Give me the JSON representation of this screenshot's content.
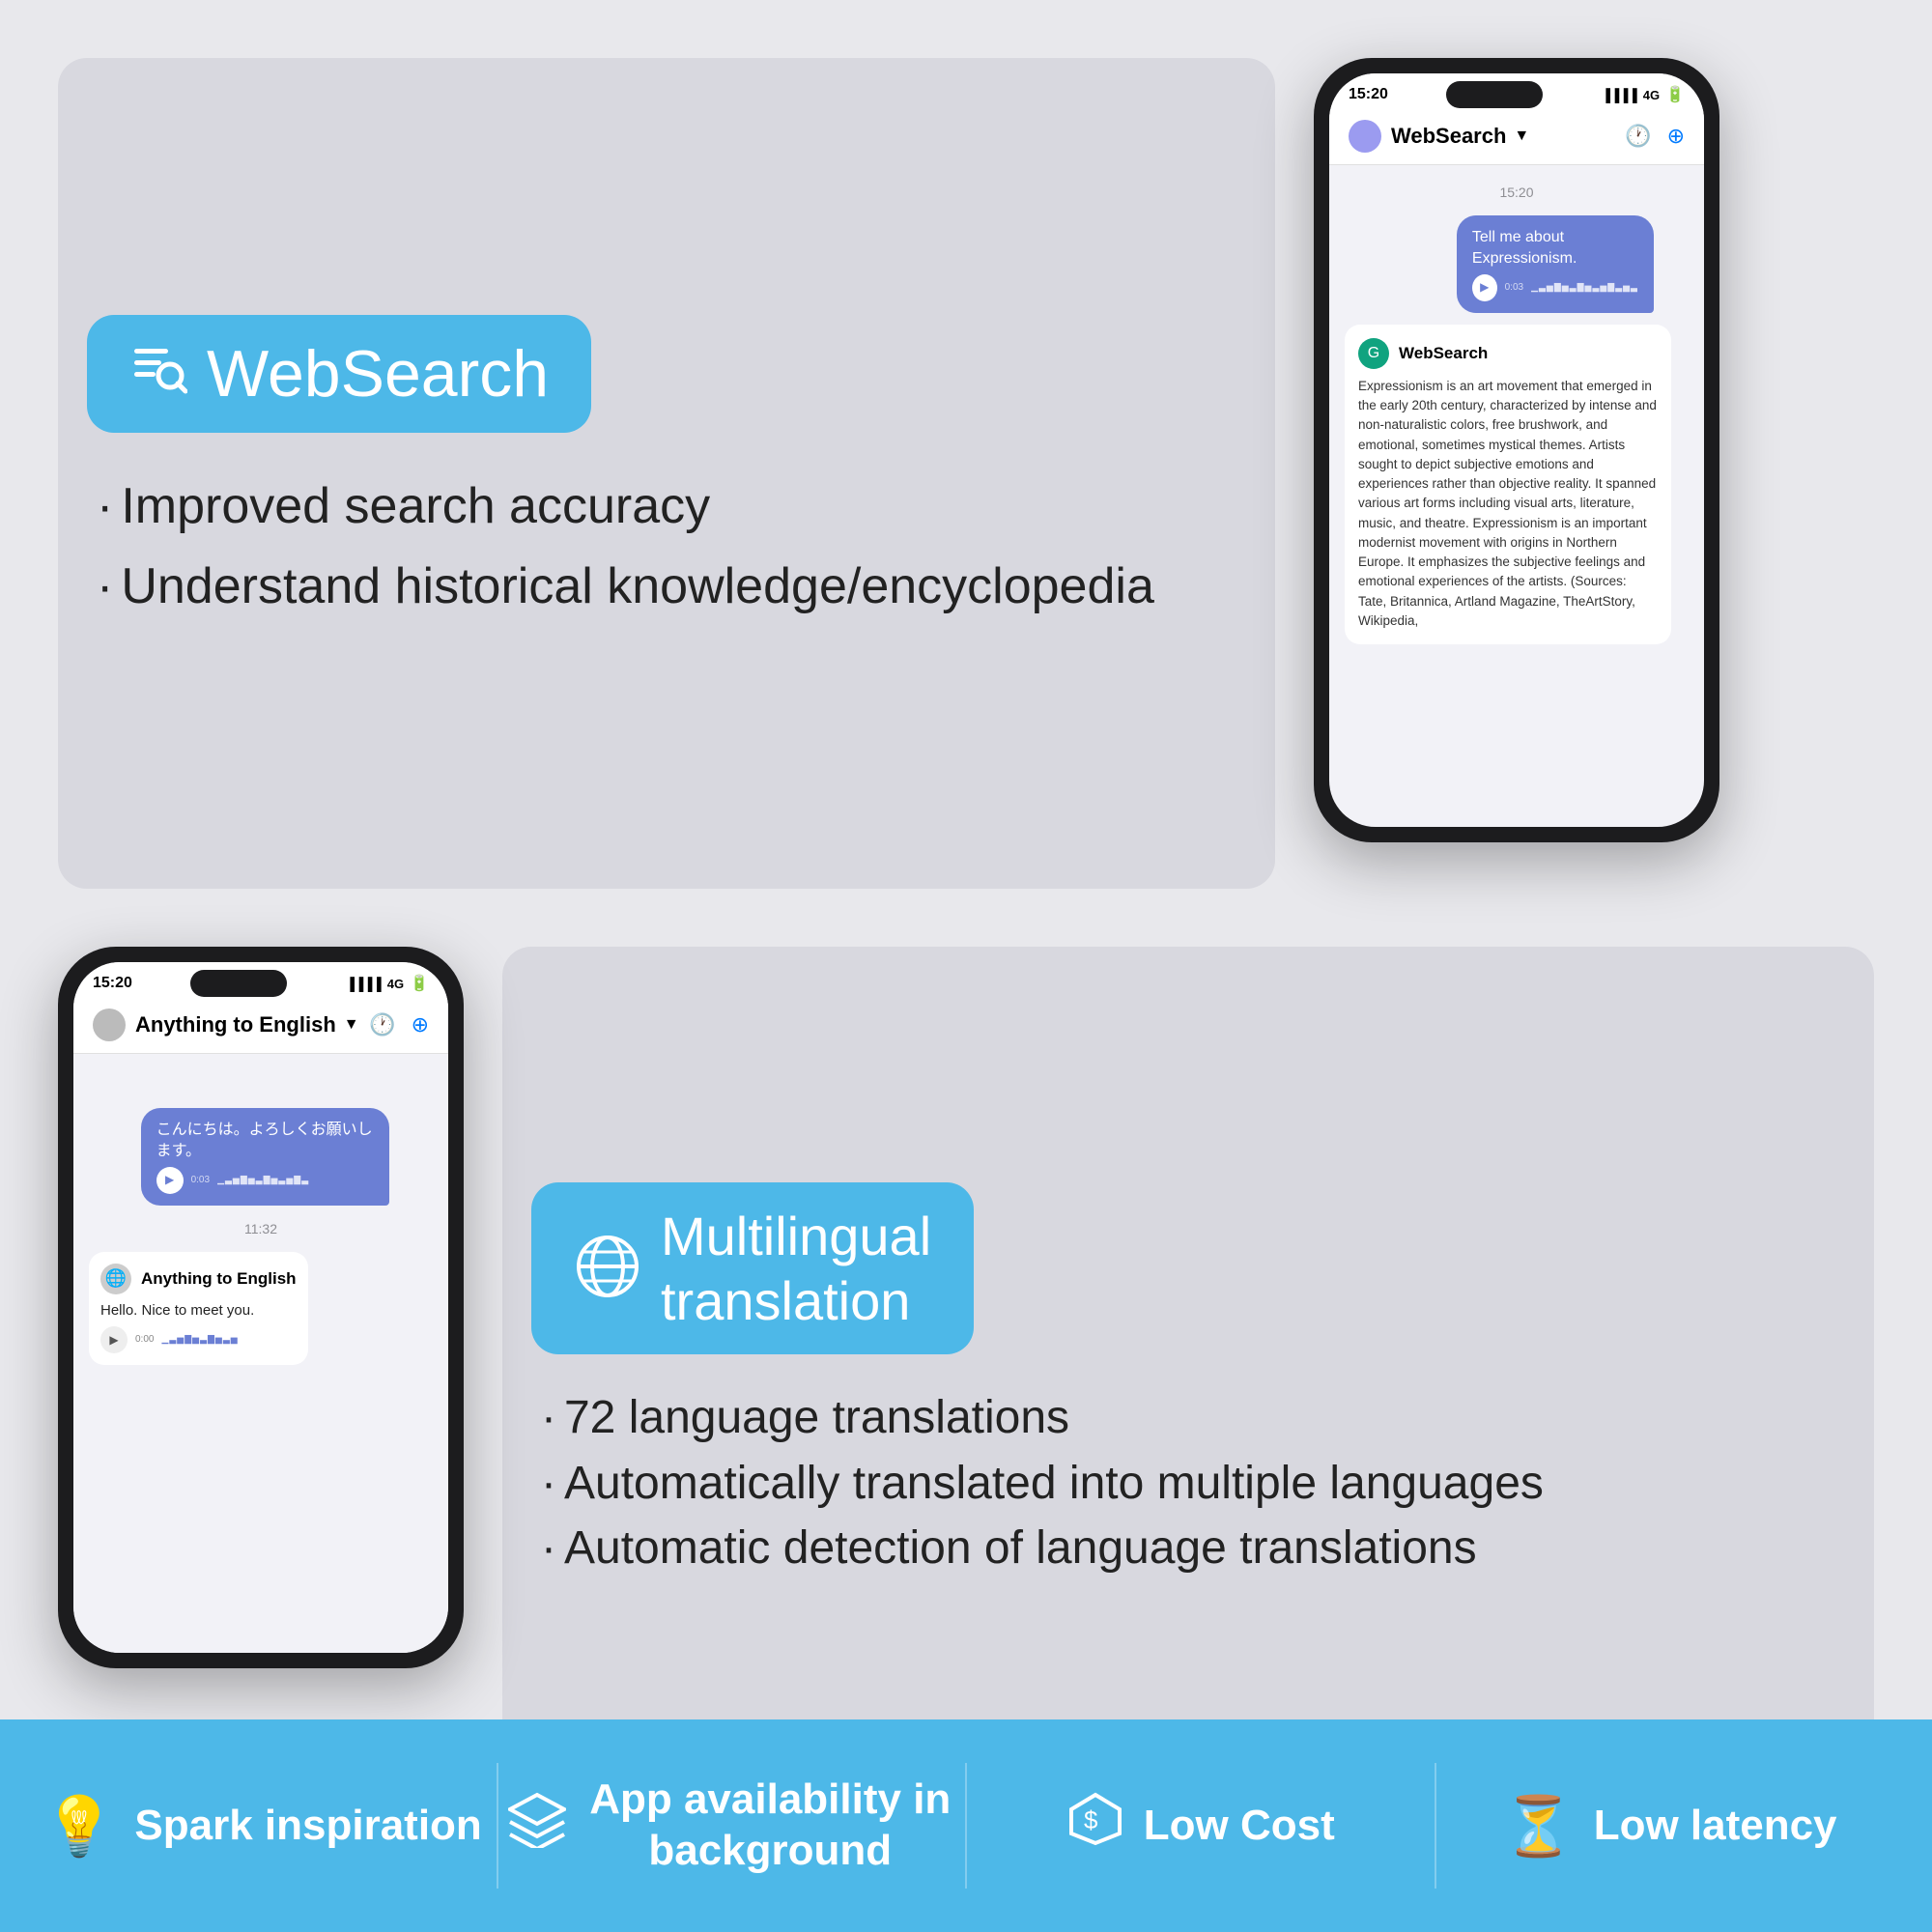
{
  "websearch": {
    "badge_text": "WebSearch",
    "feature1": "Improved search accuracy",
    "feature2": "Understand historical knowledge/encyclopedia",
    "phone1": {
      "status_time": "15:20",
      "status_signal": "4G",
      "chat_name": "WebSearch",
      "msg_time": "15:20",
      "user_msg": "Tell me about Expressionism.",
      "audio_time": "0:03",
      "bot_name": "WebSearch",
      "bot_response": "Expressionism is an art movement that emerged in the early 20th century, characterized by intense and non-naturalistic colors, free brushwork, and emotional, sometimes mystical themes. Artists sought to depict subjective emotions and experiences rather than objective reality. It spanned various art forms including visual arts, literature, music, and theatre. Expressionism is an important modernist movement with origins in Northern Europe. It emphasizes the subjective feelings and emotional experiences of the artists. (Sources: Tate, Britannica, Artland Magazine, TheArtStory, Wikipedia,"
    }
  },
  "translation": {
    "badge_text_line1": "Multilingual",
    "badge_text_line2": "translation",
    "feature1": "72 language translations",
    "feature2": "Automatically translated into multiple languages",
    "feature3": "Automatic detection of language translations",
    "phone2": {
      "status_time": "15:20",
      "status_signal": "4G",
      "chat_name": "Anything to English",
      "msg_time": "11:32",
      "user_msg_jp": "こんにちは。よろしくお願いします。",
      "audio_time_jp": "0:03",
      "bot_name": "Anything to English",
      "bot_response_en": "Hello. Nice to meet you.",
      "audio_time_en": "0:00"
    }
  },
  "footer": {
    "item1_label": "Spark inspiration",
    "item2_label": "App availability in background",
    "item3_label": "Low Cost",
    "item4_label": "Low latency"
  }
}
